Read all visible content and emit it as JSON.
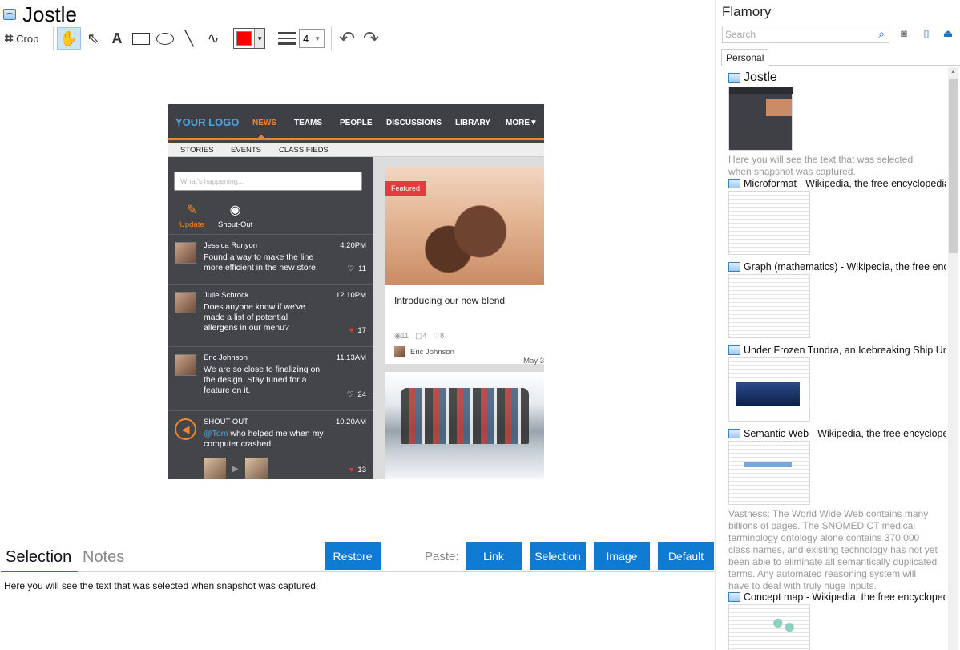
{
  "window": {
    "title": "Jostle"
  },
  "toolbar": {
    "crop_label": "Crop",
    "line_width": "4"
  },
  "snapshot": {
    "logo": "YOUR LOGO",
    "nav": [
      "NEWS",
      "TEAMS",
      "PEOPLE",
      "DISCUSSIONS",
      "LIBRARY",
      "MORE▼"
    ],
    "subnav": [
      "STORIES",
      "EVENTS",
      "CLASSIFIEDS"
    ],
    "compose_placeholder": "What's happening...",
    "actions": {
      "update": "Update",
      "shoutout": "Shout-Out"
    },
    "feed": [
      {
        "name": "Jessica Runyon",
        "time": "4.20PM",
        "text": "Found a way to make the line more efficient in the new store.",
        "likes": "11",
        "liked": false
      },
      {
        "name": "Julie Schrock",
        "time": "12.10PM",
        "text": "Does anyone know if we've made a list of potential allergens in our menu?",
        "likes": "17",
        "liked": true
      },
      {
        "name": "Eric Johnson",
        "time": "11.13AM",
        "text": "We are so close to finalizing on the design. Stay tuned for a feature on it.",
        "likes": "24",
        "liked": false
      },
      {
        "name": "SHOUT-OUT",
        "time": "10.20AM",
        "mention": "@Tom",
        "text": " who helped me when my computer crashed.",
        "likes": "13",
        "liked": true
      }
    ],
    "card": {
      "badge": "Featured",
      "title": "Introducing our new blend",
      "views": "11",
      "comments": "4",
      "likes": "8",
      "author": "Eric Johnson",
      "date": "May 3"
    }
  },
  "bottom": {
    "tab_selection": "Selection",
    "tab_notes": "Notes",
    "restore": "Restore",
    "paste_label": "Paste:",
    "paste_link": "Link",
    "paste_selection": "Selection",
    "paste_image": "Image",
    "paste_default": "Default",
    "selection_text": "Here you will see the text that was selected when snapshot was captured."
  },
  "flamory": {
    "title": "Flamory",
    "search_placeholder": "Search",
    "tab": "Personal",
    "entries": [
      {
        "title": "Jostle",
        "desc": "Here you will see the text that was selected when snapshot was captured."
      },
      {
        "title": "Microformat - Wikipedia, the free encyclopedia"
      },
      {
        "title": "Graph (mathematics) - Wikipedia, the free ency"
      },
      {
        "title": "Under Frozen Tundra, an Icebreaking Ship Unco"
      },
      {
        "title": "Semantic Web - Wikipedia, the free encycloped",
        "desc": "Vastness: The World Wide Web contains many billions of pages. The SNOMED CT medical terminology ontology alone contains 370,000 class names, and existing technology has not yet been able to eliminate all semantically duplicated terms. Any automated reasoning system will have to deal with truly huge inputs."
      },
      {
        "title": "Concept map - Wikipedia, the free encyclopedi"
      }
    ]
  },
  "colors": {
    "accent": "#0f7ad2",
    "brand_orange": "#f0852d",
    "pen_color": "#ff0000"
  }
}
